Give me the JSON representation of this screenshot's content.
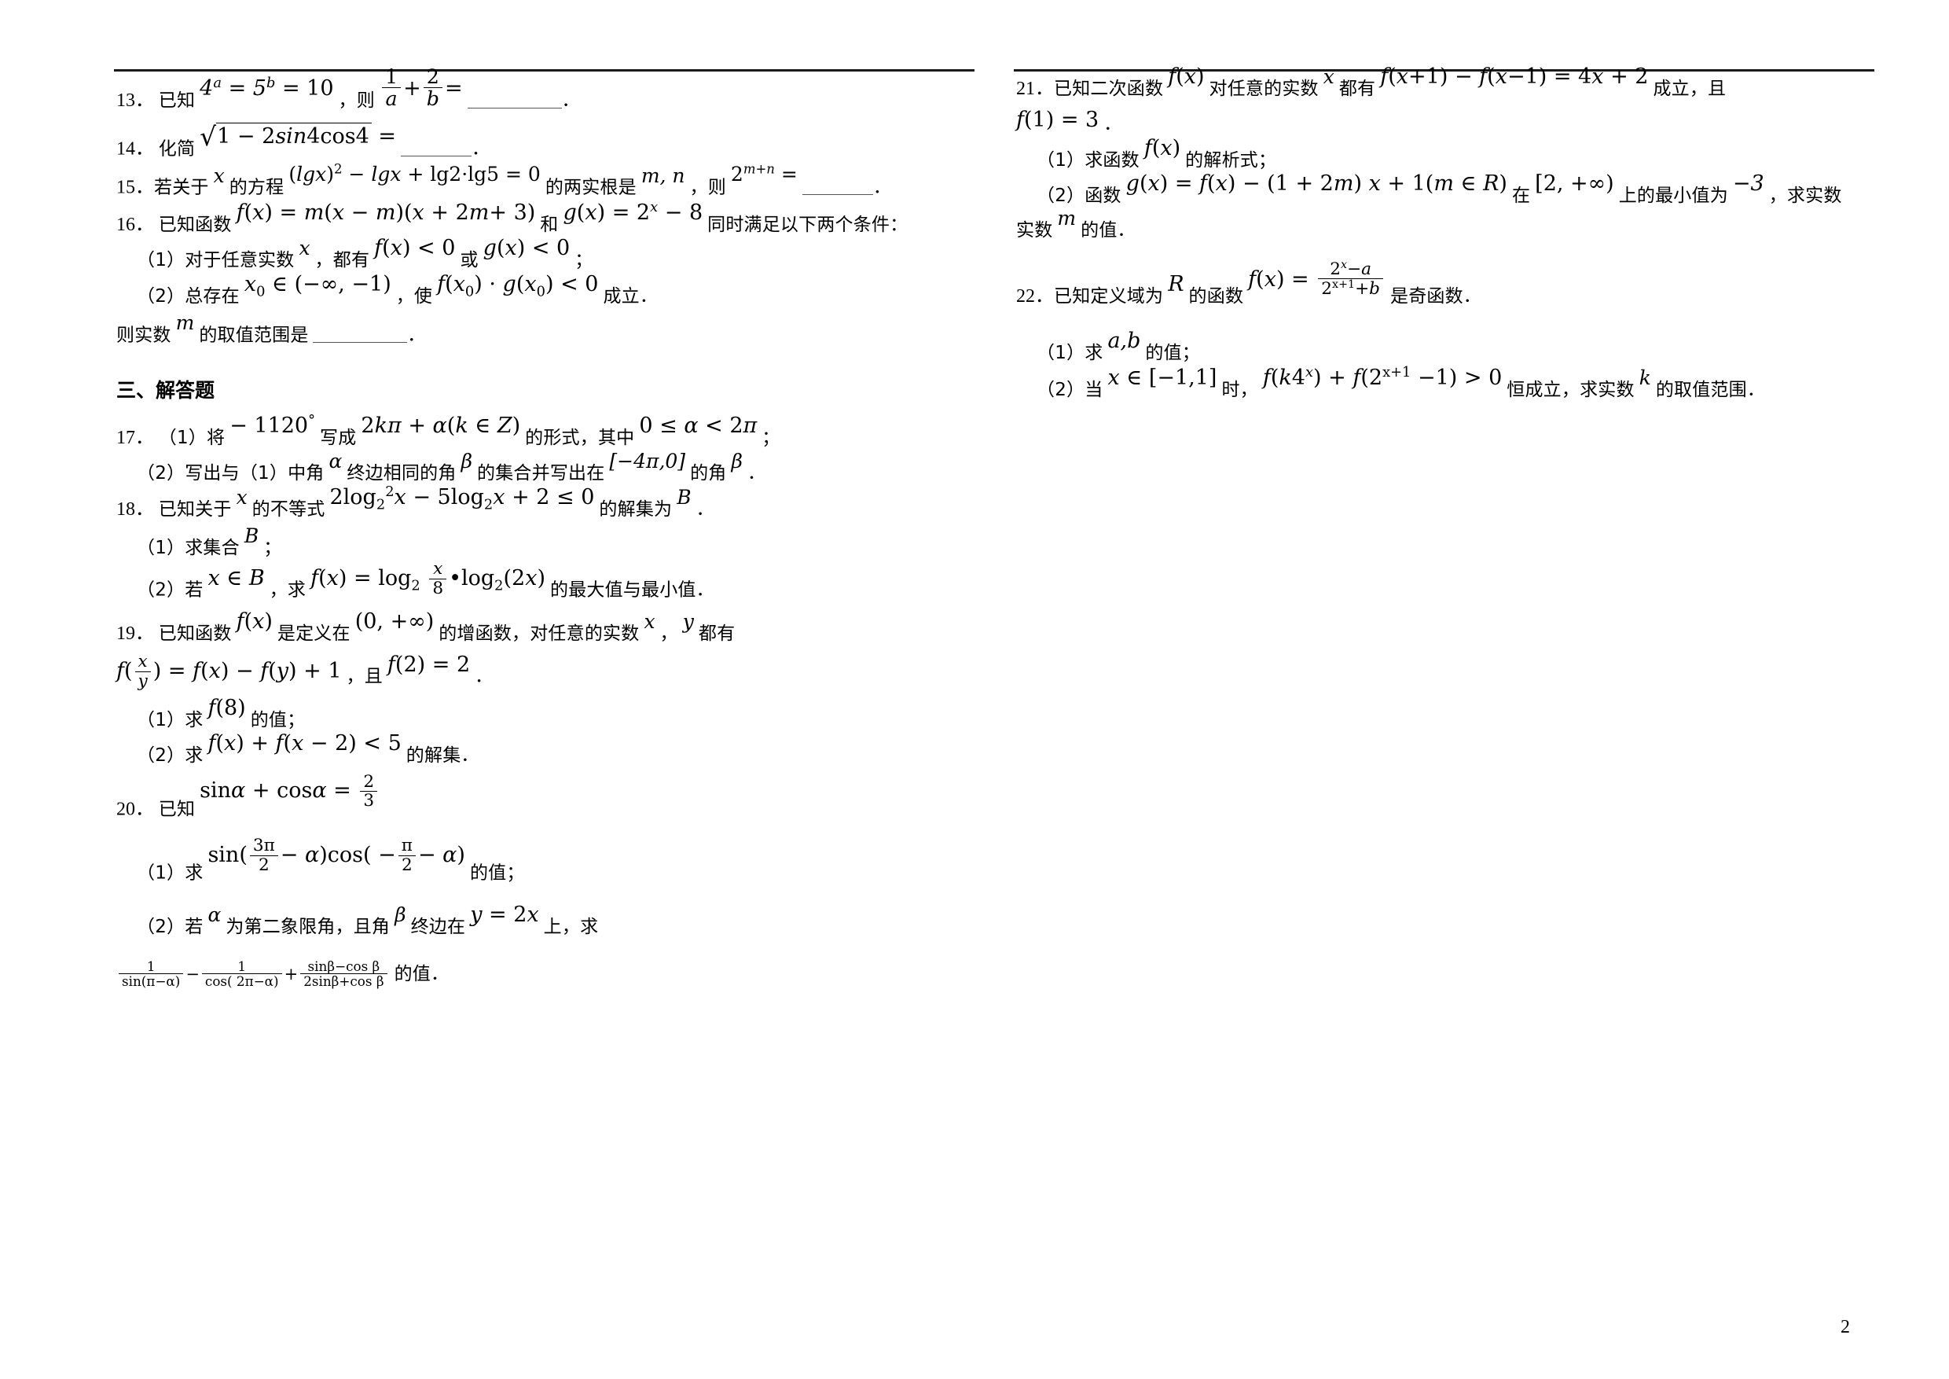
{
  "document": {
    "page_number": "2",
    "section_heading": "三、解答题"
  },
  "left_column": {
    "q13": {
      "number": "13．",
      "lead": "已知",
      "expr1": "4a = 5b = 10",
      "comma": "，则",
      "expr2": "1/a + 2/b =",
      "period": "．"
    },
    "q14": {
      "number": "14．",
      "lead": "化简",
      "expr": "√(1 − 2sin4cos4) =",
      "period": "．"
    },
    "q15": {
      "number": "15．",
      "lead": "若关于",
      "var": "x",
      "t1": "的方程",
      "equation": "(lgx)² − lgx + lg2·lg5 = 0",
      "t2": "的两实根是",
      "roots": "m, n",
      "t3": "，则",
      "expr": "2^(m+n) =",
      "period": "．"
    },
    "q16": {
      "number": "16．",
      "lead": "已知函数",
      "f": "f(x) = m(x − m)(x + 2m + 3)",
      "and": "和",
      "g": "g(x) = 2ˣ − 8",
      "tail": "同时满足以下两个条件：",
      "part1": {
        "label": "（1）",
        "t1": "对于任意实数",
        "var": "x",
        "t2": "，都有",
        "e1": "f(x) < 0",
        "or": "或",
        "e2": "g(x) < 0",
        "t3": "；"
      },
      "part2": {
        "label": "（2）",
        "t1": "总存在",
        "e1": "x₀ ∈ (−∞, −1)",
        "t2": "，使",
        "e2": "f(x₀) · g(x₀) < 0",
        "t3": "成立．"
      },
      "conclusion": {
        "t1": "则实数",
        "var": "m",
        "t2": "的取值范围是",
        "period": "．"
      }
    },
    "q17": {
      "number": "17．",
      "part1": {
        "label": "（1）",
        "t1": "将",
        "angle": "−1120°",
        "t2": "写成",
        "form": "2kπ + α(k ∈ Z)",
        "t3": "的形式，其中",
        "cond": "0 ≤ α < 2π",
        "t4": "；"
      },
      "part2": {
        "label": "（2）",
        "t1": "写出与（1）中角",
        "alpha": "α",
        "t2": "终边相同的角",
        "beta": "β",
        "t3": "的集合并写出在",
        "interval": "[−4π,0]",
        "t4": "的角",
        "beta2": "β",
        "t5": "．"
      }
    },
    "q18": {
      "number": "18．",
      "lead": "已知关于",
      "var": "x",
      "t1": "的不等式",
      "inequality": "2log₂²x − 5log₂x + 2 ≤ 0",
      "t2": "的解集为",
      "setB": "B",
      "period": "．",
      "part1": {
        "label": "（1）",
        "t1": "求集合",
        "setB": "B",
        "t2": "；"
      },
      "part2": {
        "label": "（2）",
        "t1": "若",
        "cond": "x ∈ B",
        "t2": "，求",
        "func": "f(x) = log₂(x/8)•log₂(2x)",
        "t3": "的最大值与最小值．"
      }
    },
    "q19": {
      "number": "19．",
      "lead": "已知函数",
      "f": "f(x)",
      "t1": "是定义在",
      "domain": "(0, +∞)",
      "t2": "的增函数，对任意的实数",
      "x": "x",
      "comma": "，",
      "y": "y",
      "t3": "都有",
      "equation": "f(x/y) = f(x) − f(y) + 1",
      "t4": "，且",
      "given": "f(2) = 2",
      "t5": "．",
      "part1": {
        "label": "（1）",
        "t1": "求",
        "expr": "f(8)",
        "t2": "的值；"
      },
      "part2": {
        "label": "（2）",
        "t1": "求",
        "expr": "f(x) + f(x − 2) < 5",
        "t2": "的解集．"
      }
    },
    "q20": {
      "number": "20．",
      "lead": "已知",
      "given": "sinα + cosα = 2/3",
      "part1": {
        "label": "（1）",
        "t1": "求",
        "expr": "sin(3π/2 − α)cos(−π/2 − α)",
        "t2": "的值；"
      },
      "part2": {
        "label": "（2）",
        "t1": "若",
        "alpha": "α",
        "t2": "为第二象限角，且角",
        "beta": "β",
        "t3": "终边在",
        "line": "y = 2x",
        "t4": "上，求",
        "expr": "1/sin(π−α) − 1/cos(2π−α) + (sinβ−cosβ)/(2sinβ+cosβ)",
        "t5": "的值．"
      }
    }
  },
  "right_column": {
    "q21": {
      "number": "21．",
      "lead": "已知二次函数",
      "f": "f(x)",
      "t1": "对任意的实数",
      "var": "x",
      "t2": "都有",
      "equation": "f(x+1) − f(x−1) = 4x + 2",
      "t3": "成立，且",
      "given": "f(1) = 3",
      "t4": "．",
      "part1": {
        "label": "（1）",
        "t1": "求函数",
        "f": "f(x)",
        "t2": "的解析式；"
      },
      "part2": {
        "label": "（2）",
        "t1": "函数",
        "g": "g(x) = f(x) − (1 + 2m)x + 1(m ∈ R)",
        "t2": "在",
        "interval": "[2, +∞)",
        "t3": "上的最小值为",
        "minval": "−3",
        "t4": "，求实数",
        "m": "m",
        "t5": "的值．"
      }
    },
    "q22": {
      "number": "22．",
      "lead": "已知定义域为",
      "R": "R",
      "t1": "的函数",
      "f": "f(x) = (2ˣ − a)/(2ˣ⁺¹ + b)",
      "t2": "是奇函数．",
      "part1": {
        "label": "（1）",
        "t1": "求",
        "ab": "a,b",
        "t2": "的值；"
      },
      "part2": {
        "label": "（2）",
        "t1": "当",
        "range": "x ∈ [−1,1]",
        "t2": "时，",
        "inequality": "f(k4ˣ) + f(2ˣ⁺¹ − 1) > 0",
        "t3": "恒成立，求实数",
        "k": "k",
        "t4": "的取值范围．"
      }
    }
  }
}
